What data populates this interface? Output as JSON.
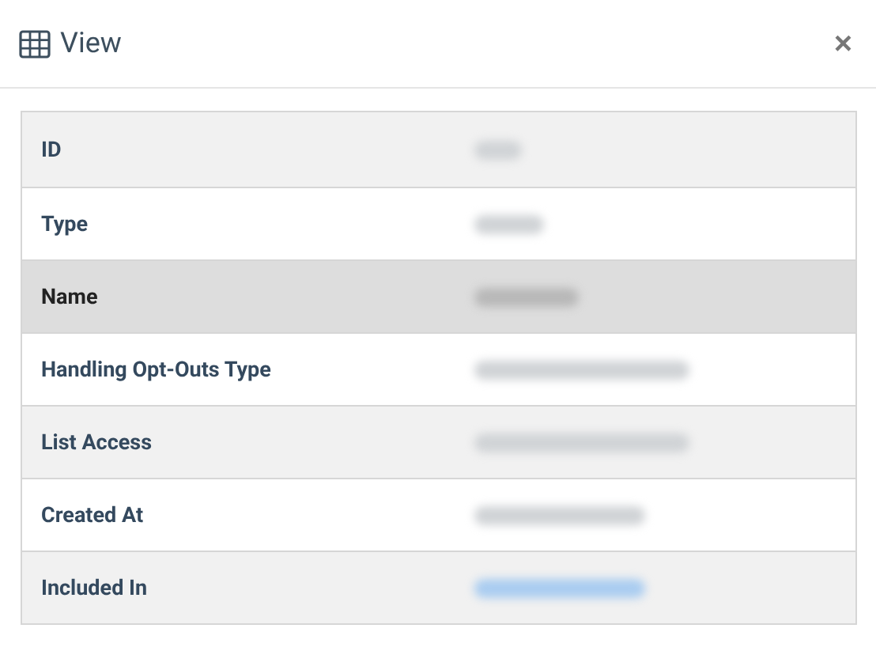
{
  "dialog": {
    "title": "View",
    "close": "×"
  },
  "rows": [
    {
      "label": "ID",
      "highlighted": false,
      "value_is_link": false
    },
    {
      "label": "Type",
      "highlighted": false,
      "value_is_link": false
    },
    {
      "label": "Name",
      "highlighted": true,
      "value_is_link": false
    },
    {
      "label": "Handling Opt-Outs Type",
      "highlighted": false,
      "value_is_link": false
    },
    {
      "label": "List Access",
      "highlighted": false,
      "value_is_link": false
    },
    {
      "label": "Created At",
      "highlighted": false,
      "value_is_link": false
    },
    {
      "label": "Included In",
      "highlighted": false,
      "value_is_link": true
    }
  ]
}
